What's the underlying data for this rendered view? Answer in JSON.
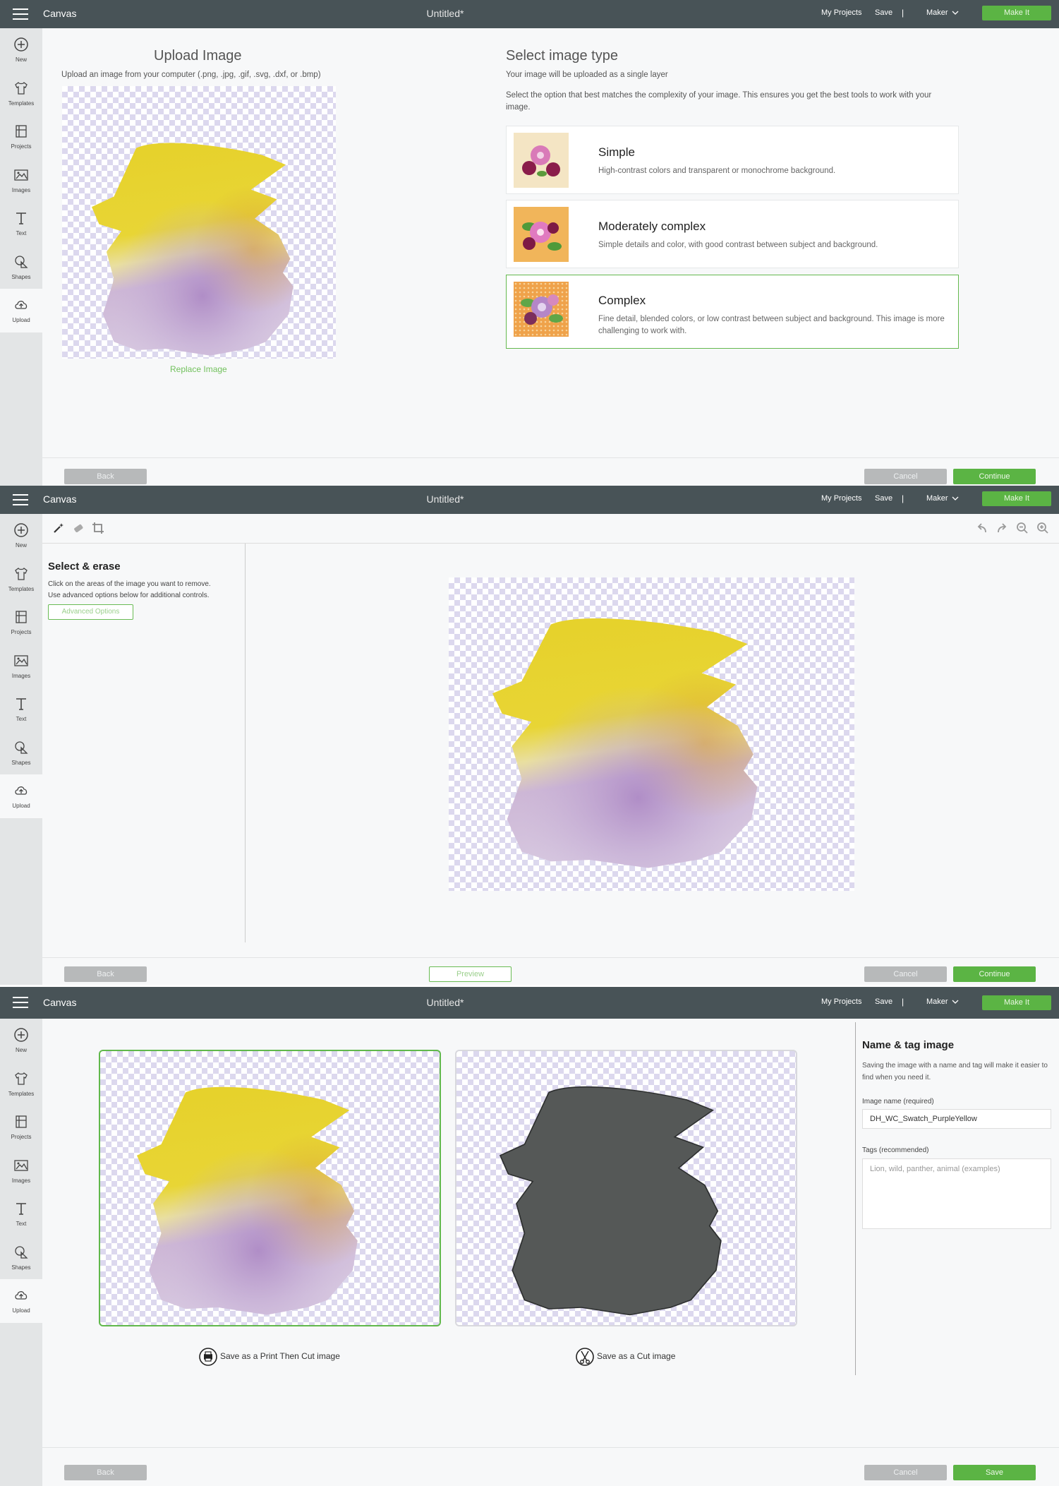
{
  "topbar": {
    "app_name": "Canvas",
    "document_title": "Untitled*",
    "my_projects": "My Projects",
    "save": "Save",
    "separator": "|",
    "machine": "Maker",
    "make_it": "Make It"
  },
  "sidebar": {
    "items": [
      {
        "label": "New",
        "icon": "plus-circle-icon"
      },
      {
        "label": "Templates",
        "icon": "tshirt-icon"
      },
      {
        "label": "Projects",
        "icon": "projects-icon"
      },
      {
        "label": "Images",
        "icon": "image-icon"
      },
      {
        "label": "Text",
        "icon": "text-icon"
      },
      {
        "label": "Shapes",
        "icon": "shapes-icon"
      },
      {
        "label": "Upload",
        "icon": "cloud-upload-icon"
      }
    ],
    "active": "Upload"
  },
  "step1": {
    "upload_title": "Upload Image",
    "upload_hint": "Upload an image from your computer (.png, .jpg, .gif, .svg, .dxf, or .bmp)",
    "replace_link": "Replace Image",
    "select_title": "Select image type",
    "select_subtitle": "Your image will be uploaded as a single layer",
    "select_description": "Select the option that best matches the complexity of your image. This ensures you get the best tools to work with your image.",
    "options": [
      {
        "name": "Simple",
        "description": "High-contrast colors and transparent or monochrome background."
      },
      {
        "name": "Moderately complex",
        "description": "Simple details and color, with good contrast between subject and background."
      },
      {
        "name": "Complex",
        "description": "Fine detail, blended colors, or low contrast between subject and background. This image is more challenging to work with."
      }
    ],
    "selected_option": "Complex",
    "back": "Back",
    "cancel": "Cancel",
    "continue": "Continue"
  },
  "step2": {
    "tools": [
      "magic-wand-icon",
      "eraser-icon",
      "crop-icon"
    ],
    "right_tools": [
      "undo-icon",
      "redo-icon",
      "zoom-out-icon",
      "zoom-in-icon"
    ],
    "title": "Select & erase",
    "line1": "Click on the areas of the image you want to remove.",
    "line2": "Use advanced options below for additional controls.",
    "advanced_options": "Advanced Options",
    "back": "Back",
    "preview": "Preview",
    "cancel": "Cancel",
    "continue": "Continue"
  },
  "step3": {
    "print_then_cut_label": "Save as a Print Then Cut image",
    "cut_label": "Save as a Cut image",
    "selected_card": "print-then-cut",
    "name_tag_title": "Name & tag image",
    "name_tag_description": "Saving the image with a name and tag will make it easier to find when you need it.",
    "image_name_label": "Image name (required)",
    "image_name_value": "DH_WC_Swatch_PurpleYellow",
    "tags_label": "Tags (recommended)",
    "tags_placeholder": "Lion, wild, panther, animal (examples)",
    "back": "Back",
    "cancel": "Cancel",
    "save": "Save"
  },
  "colors": {
    "topbar": "#485357",
    "accent_green": "#5bb444",
    "sidebar": "#e3e5e6",
    "checker": "#dcd8ee",
    "cut_silhouette": "#555857"
  }
}
